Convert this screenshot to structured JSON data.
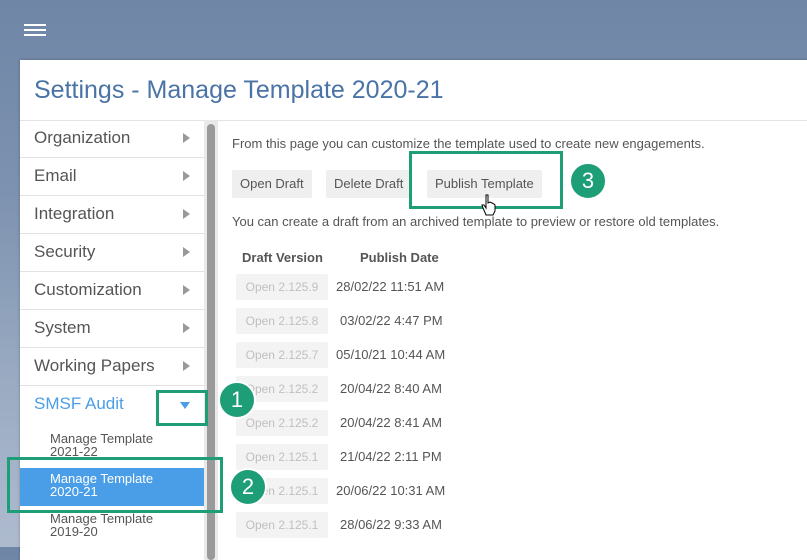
{
  "header": {
    "menu_icon": "hamburger-menu-icon"
  },
  "page": {
    "title": "Settings - Manage Template 2020-21"
  },
  "sidebar": {
    "items": [
      {
        "label": "Organization",
        "icon": "chevron-right-icon"
      },
      {
        "label": "Email",
        "icon": "chevron-right-icon"
      },
      {
        "label": "Integration",
        "icon": "chevron-right-icon"
      },
      {
        "label": "Security",
        "icon": "chevron-right-icon"
      },
      {
        "label": "Customization",
        "icon": "chevron-right-icon"
      },
      {
        "label": "System",
        "icon": "chevron-right-icon"
      },
      {
        "label": "Working Papers",
        "icon": "chevron-right-icon"
      },
      {
        "label": "SMSF Audit",
        "icon": "chevron-down-icon",
        "active": true
      }
    ],
    "sub_items": [
      {
        "label": "Manage Template 2021-22"
      },
      {
        "label": "Manage Template 2020-21",
        "selected": true
      },
      {
        "label": "Manage Template 2019-20"
      }
    ],
    "active_color": "#4a9ee8"
  },
  "main": {
    "intro": "From this page you can customize the template used to create new engagements.",
    "buttons": {
      "open_draft": "Open Draft",
      "delete_draft": "Delete Draft",
      "publish_template": "Publish Template"
    },
    "note": "You can create a draft from an archived template to preview or restore old templates.",
    "table": {
      "headers": [
        "Draft Version",
        "Publish Date"
      ],
      "rows": [
        {
          "action": "Open 2.125.9",
          "date": "28/02/22 11:51 AM"
        },
        {
          "action": "Open 2.125.8",
          "date": "03/02/22 4:47 PM"
        },
        {
          "action": "Open 2.125.7",
          "date": "05/10/21 10:44 AM"
        },
        {
          "action": "Open 2.125.2",
          "date": "20/04/22 8:40 AM"
        },
        {
          "action": "Open 2.125.2",
          "date": "20/04/22 8:41 AM"
        },
        {
          "action": "Open 2.125.1",
          "date": "21/04/22 2:11 PM"
        },
        {
          "action": "Open 2.125.1",
          "date": "20/06/22 10:31 AM"
        },
        {
          "action": "Open 2.125.1",
          "date": "28/06/22 9:33 AM"
        }
      ]
    }
  },
  "annotations": {
    "step1": "1",
    "step2": "2",
    "step3": "3",
    "color": "#1d9e76"
  }
}
